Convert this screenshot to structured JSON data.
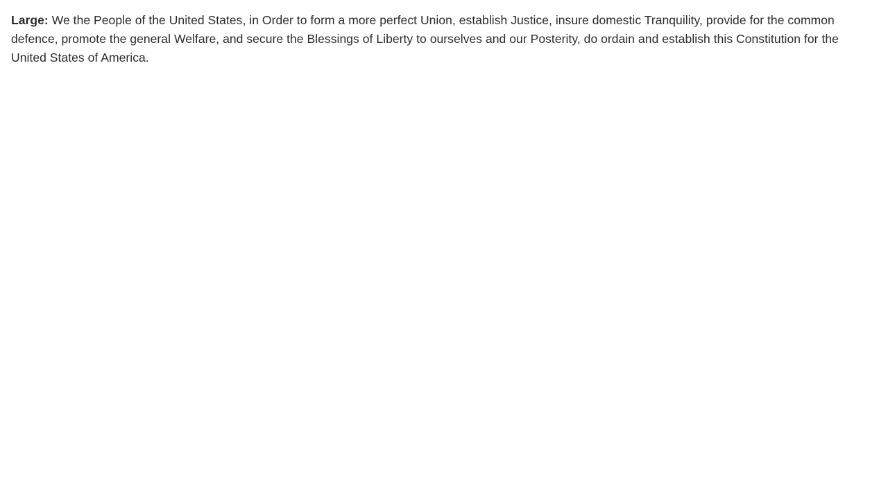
{
  "sample": {
    "label": "Large:",
    "text": " We the People of the United States, in Order to form a more perfect Union, establish Justice, insure domestic Tranquility, provide for the common defence, promote the general Welfare, and secure the Blessings of Liberty to ourselves and our Posterity, do ordain and establish this Constitution for the United States of America."
  },
  "colors": {
    "text": "#2b2b2b",
    "background": "#ffffff"
  }
}
